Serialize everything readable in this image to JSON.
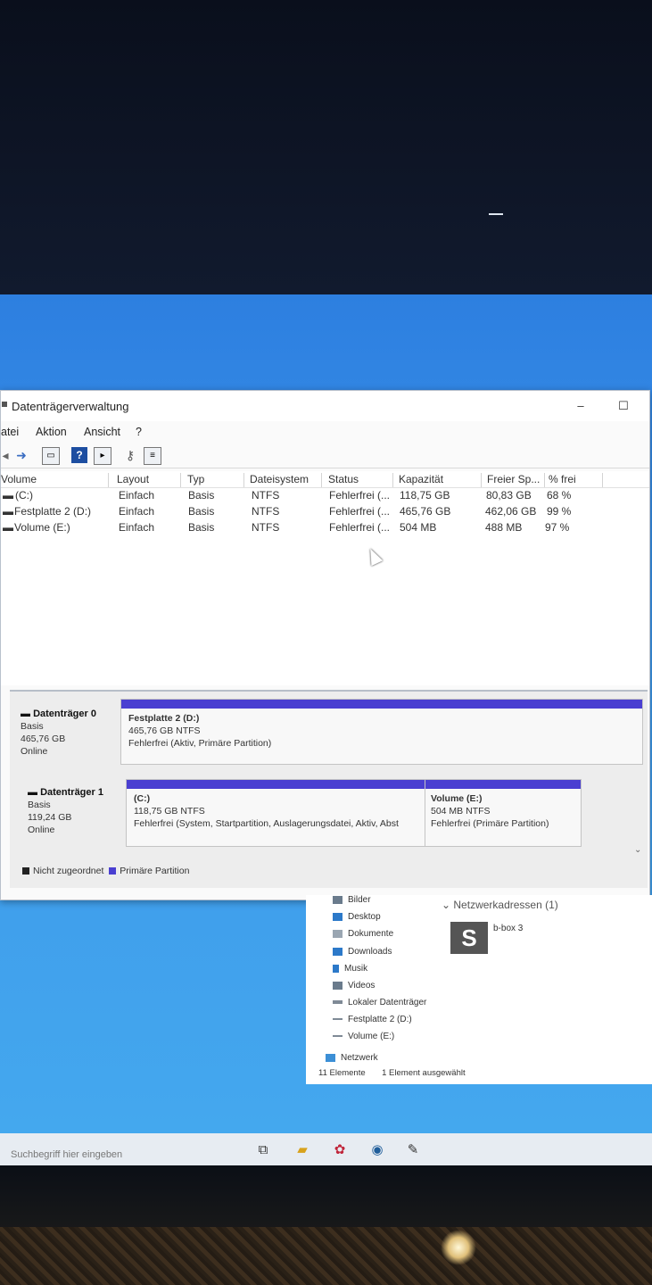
{
  "window": {
    "title": "Datenträgerverwaltung",
    "buttons": {
      "minimize": "–",
      "maximize": "☐"
    }
  },
  "menu": [
    "atei",
    "Aktion",
    "Ansicht",
    "?"
  ],
  "toolbar": [
    "back-icon",
    "forward-icon",
    "properties-icon",
    "help-icon",
    "panel-icon",
    "key-icon",
    "console-icon"
  ],
  "volume_list": {
    "columns": [
      "Volume",
      "Layout",
      "Typ",
      "Dateisystem",
      "Status",
      "Kapazität",
      "Freier Sp...",
      "% frei"
    ],
    "rows": [
      [
        "(C:)",
        "Einfach",
        "Basis",
        "NTFS",
        "Fehlerfrei (...",
        "118,75 GB",
        "80,83 GB",
        "68 %"
      ],
      [
        "Festplatte 2 (D:)",
        "Einfach",
        "Basis",
        "NTFS",
        "Fehlerfrei (...",
        "465,76 GB",
        "462,06 GB",
        "99 %"
      ],
      [
        "Volume (E:)",
        "Einfach",
        "Basis",
        "NTFS",
        "Fehlerfrei (...",
        "504 MB",
        "488 MB",
        "97 %"
      ]
    ]
  },
  "disks": [
    {
      "name": "Datenträger 0",
      "type": "Basis",
      "size": "465,76 GB",
      "state": "Online",
      "partitions": [
        {
          "name": "Festplatte 2  (D:)",
          "size": "465,76 GB NTFS",
          "status": "Fehlerfrei (Aktiv, Primäre Partition)"
        }
      ]
    },
    {
      "name": "Datenträger 1",
      "type": "Basis",
      "size": "119,24 GB",
      "state": "Online",
      "partitions": [
        {
          "name": "(C:)",
          "size": "118,75 GB NTFS",
          "status": "Fehlerfrei (System, Startpartition, Auslagerungsdatei, Aktiv, Abst"
        },
        {
          "name": "Volume  (E:)",
          "size": "504 MB NTFS",
          "status": "Fehlerfrei (Primäre Partition)"
        }
      ]
    }
  ],
  "legend": [
    {
      "label": "Nicht zugeordnet",
      "color": "#222222"
    },
    {
      "label": "Primäre Partition",
      "color": "#4a3fd1"
    }
  ],
  "explorer": {
    "nav": [
      "Bilder",
      "Desktop",
      "Dokumente",
      "Downloads",
      "Musik",
      "Videos",
      "Lokaler Datenträger",
      "Festplatte 2 (D:)",
      "Volume (E:)",
      "Netzwerk"
    ],
    "network_header": "Netzwerkadressen (1)",
    "network_item": "b-box 3",
    "network_tile_letter": "S",
    "status_count": "11 Elemente",
    "status_selected": "1 Element ausgewählt"
  },
  "taskbar": {
    "search_placeholder": "Suchbegriff hier eingeben"
  }
}
